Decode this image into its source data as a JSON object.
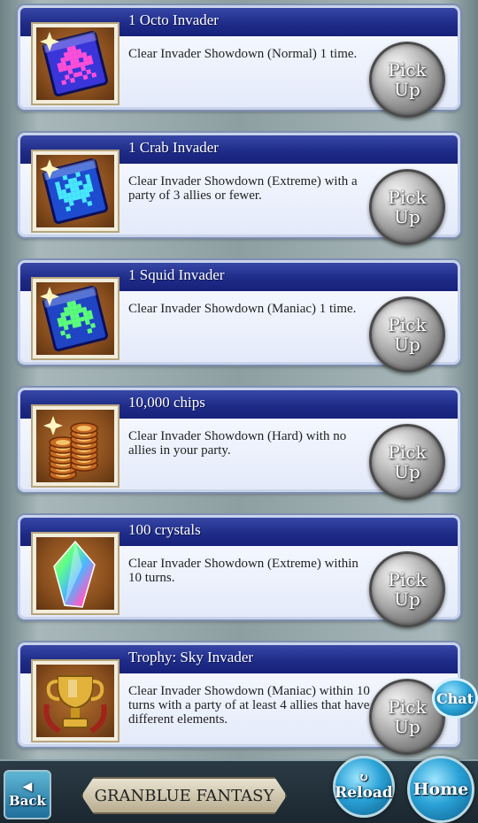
{
  "missions": [
    {
      "title": "1 Octo Invader",
      "desc": "Clear Invader Showdown (Normal) 1 time.",
      "icon": "octo-invader-icon",
      "icon_color": "#ff4fd8",
      "tile_color": "#3a35d8",
      "button": [
        "Pick",
        "Up"
      ]
    },
    {
      "title": "1 Crab Invader",
      "desc": "Clear Invader Showdown (Extreme) with a party of 3 allies or fewer.",
      "icon": "crab-invader-icon",
      "icon_color": "#48e8ff",
      "tile_color": "#1e4cd0",
      "button": [
        "Pick",
        "Up"
      ]
    },
    {
      "title": "1 Squid Invader",
      "desc": "Clear Invader Showdown (Maniac) 1 time.",
      "icon": "squid-invader-icon",
      "icon_color": "#5cff7a",
      "tile_color": "#1f45c4",
      "button": [
        "Pick",
        "Up"
      ]
    },
    {
      "title": "10,000 chips",
      "desc": "Clear Invader Showdown (Hard) with no allies in your party.",
      "icon": "chips-icon",
      "icon_color": "#d67a2a",
      "button": [
        "Pick",
        "Up"
      ]
    },
    {
      "title": "100 crystals",
      "desc": "Clear Invader Showdown (Extreme) within 10 turns.",
      "icon": "crystal-icon",
      "icon_color": "#ff66cc",
      "button": [
        "Pick",
        "Up"
      ]
    },
    {
      "title": "Trophy: Sky Invader",
      "desc": "Clear Invader Showdown (Maniac) within 10 turns with a party of at least 4 allies that have different elements.",
      "icon": "trophy-icon",
      "icon_color": "#e2b23a",
      "button": [
        "Pick",
        "Up"
      ]
    }
  ],
  "footer": {
    "back_label": "Back",
    "logo_text": "GRANBLUE FANTASY",
    "reload_label": "Reload",
    "home_label": "Home"
  },
  "chat_label": "Chat"
}
